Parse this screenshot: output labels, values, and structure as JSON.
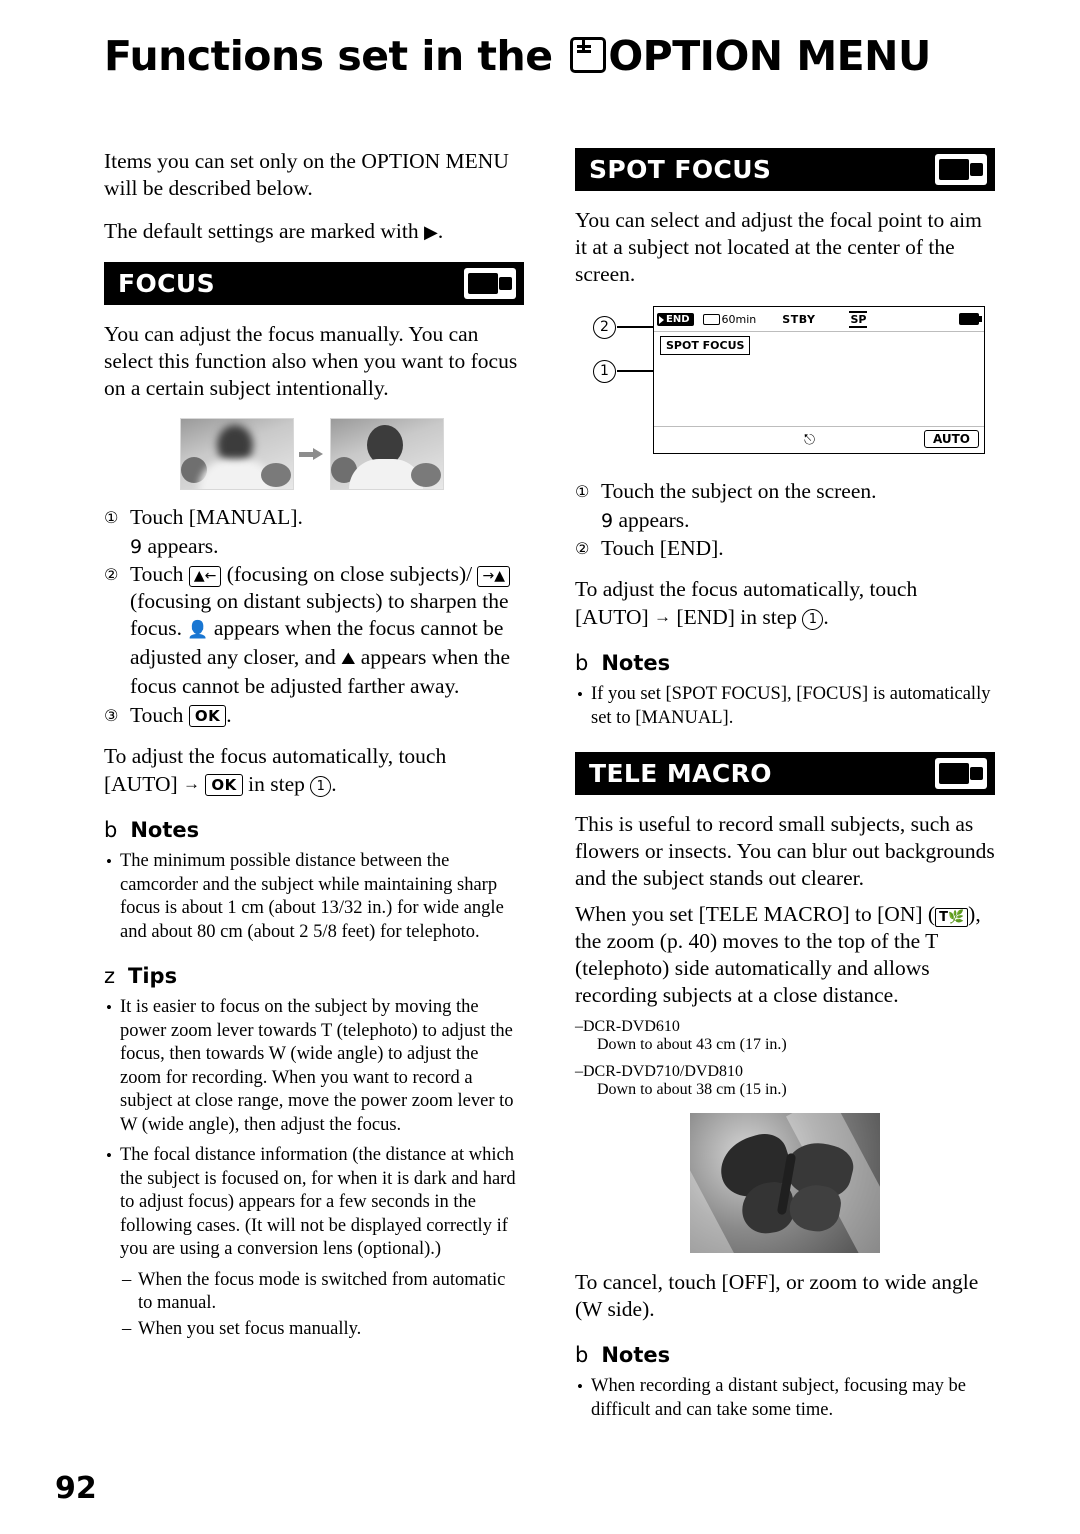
{
  "title": {
    "prefix": "Functions set in the",
    "suffix": "OPTION MENU",
    "icon": "option-menu-icon"
  },
  "page_number": "92",
  "left_column": {
    "intro": "Items you can set only on the OPTION MENU will be described below.",
    "default_note_prefix": "The default settings are marked with",
    "default_note_suffix": ".",
    "default_marker": "▶",
    "focus_section": {
      "heading": "FOCUS",
      "icon": "camcorder-mode-icon",
      "body": "You can adjust the focus manually. You can select this function also when you want to focus on a certain subject intentionally.",
      "figure": {
        "name": "focus-example-photos",
        "left_photo_alt": "blurred-subject-photo",
        "right_photo_alt": "focused-subject-photo",
        "arrow": "→"
      },
      "steps": [
        {
          "num": "①",
          "text": "Touch [MANUAL].",
          "sub": "appears.",
          "sub_glyph": "9"
        },
        {
          "num": "②",
          "text_parts": {
            "a": "Touch",
            "near_key": "▲←",
            "b": "(focusing on close subjects)/",
            "far_key": "→▲",
            "c": "(focusing on distant subjects) to sharpen the focus.",
            "d": "appears when the focus cannot be adjusted any closer, and",
            "e": "appears when the focus cannot be adjusted farther away."
          }
        },
        {
          "num": "③",
          "text_prefix": "Touch",
          "key": "OK",
          "text_suffix": "."
        }
      ],
      "auto_note": {
        "a": "To adjust the focus automatically, touch [AUTO]",
        "arrow": "→",
        "key": "OK",
        "b": "in step",
        "step_num": "①",
        "c": "."
      },
      "notes": {
        "glyph": "b",
        "label": "Notes",
        "items": [
          "The minimum possible distance between the camcorder and the subject while maintaining sharp focus is about 1 cm (about 13/32 in.) for wide angle and about 80 cm (about 2 5/8 feet) for telephoto."
        ]
      },
      "tips": {
        "glyph": "z",
        "label": "Tips",
        "items": [
          "It is easier to focus on the subject by moving the power zoom lever towards T (telephoto) to adjust the focus, then towards W (wide angle) to adjust the zoom for recording. When you want to record a subject at close range, move the power zoom lever to W (wide angle), then adjust the focus.",
          "The focal distance information (the distance at which the subject is focused on, for when it is dark and hard to adjust focus) appears for a few seconds in the following cases. (It will not be displayed correctly if you are using a conversion lens (optional).)"
        ],
        "sub_items": [
          "When the focus mode is switched from automatic to manual.",
          "When you set focus manually."
        ]
      }
    }
  },
  "right_column": {
    "spot_focus_section": {
      "heading": "SPOT FOCUS",
      "icon": "camcorder-mode-icon",
      "body": "You can select and adjust the focal point to aim it at a subject not located at the center of the screen.",
      "screen": {
        "name": "spot-focus-lcd-diagram",
        "end_badge": "END",
        "tape_time": "60min",
        "status": "STBY",
        "quality": "SP",
        "battery": "battery-icon",
        "spot_label": "SPOT FOCUS",
        "auto_button": "AUTO",
        "back_icon": "return-icon",
        "callout_1": "①",
        "callout_2": "②"
      },
      "steps": [
        {
          "num": "①",
          "text": "Touch the subject on the screen.",
          "sub_glyph": "9",
          "sub": "appears."
        },
        {
          "num": "②",
          "text": "Touch [END]."
        }
      ],
      "auto_note": {
        "a": "To adjust the focus automatically, touch [AUTO]",
        "arrow": "→",
        "b": "[END] in step",
        "step_num": "①",
        "c": "."
      },
      "notes": {
        "glyph": "b",
        "label": "Notes",
        "items": [
          "If you set [SPOT FOCUS], [FOCUS] is automatically set to [MANUAL]."
        ]
      }
    },
    "tele_macro_section": {
      "heading": "TELE MACRO",
      "icon": "camcorder-mode-icon",
      "body_1": "This is useful to record small subjects, such as flowers or insects. You can blur out backgrounds and the subject stands out clearer.",
      "body_2_a": "When you set [TELE MACRO] to [ON]",
      "body_2_icon": "T-macro-icon",
      "body_2_b": ", the zoom (p. 40) moves to the top of the T (telephoto) side automatically and allows recording subjects at a close distance.",
      "models": [
        {
          "name": "–DCR-DVD610",
          "spec": "Down to about 43 cm (17 in.)"
        },
        {
          "name": "–DCR-DVD710/DVD810",
          "spec": "Down to about 38 cm (15 in.)"
        }
      ],
      "photo_alt": "butterfly-macro-photo",
      "cancel_note": "To cancel, touch [OFF], or zoom to wide angle (W side).",
      "notes": {
        "glyph": "b",
        "label": "Notes",
        "items": [
          "When recording a distant subject, focusing may be difficult and can take some time."
        ]
      }
    }
  }
}
